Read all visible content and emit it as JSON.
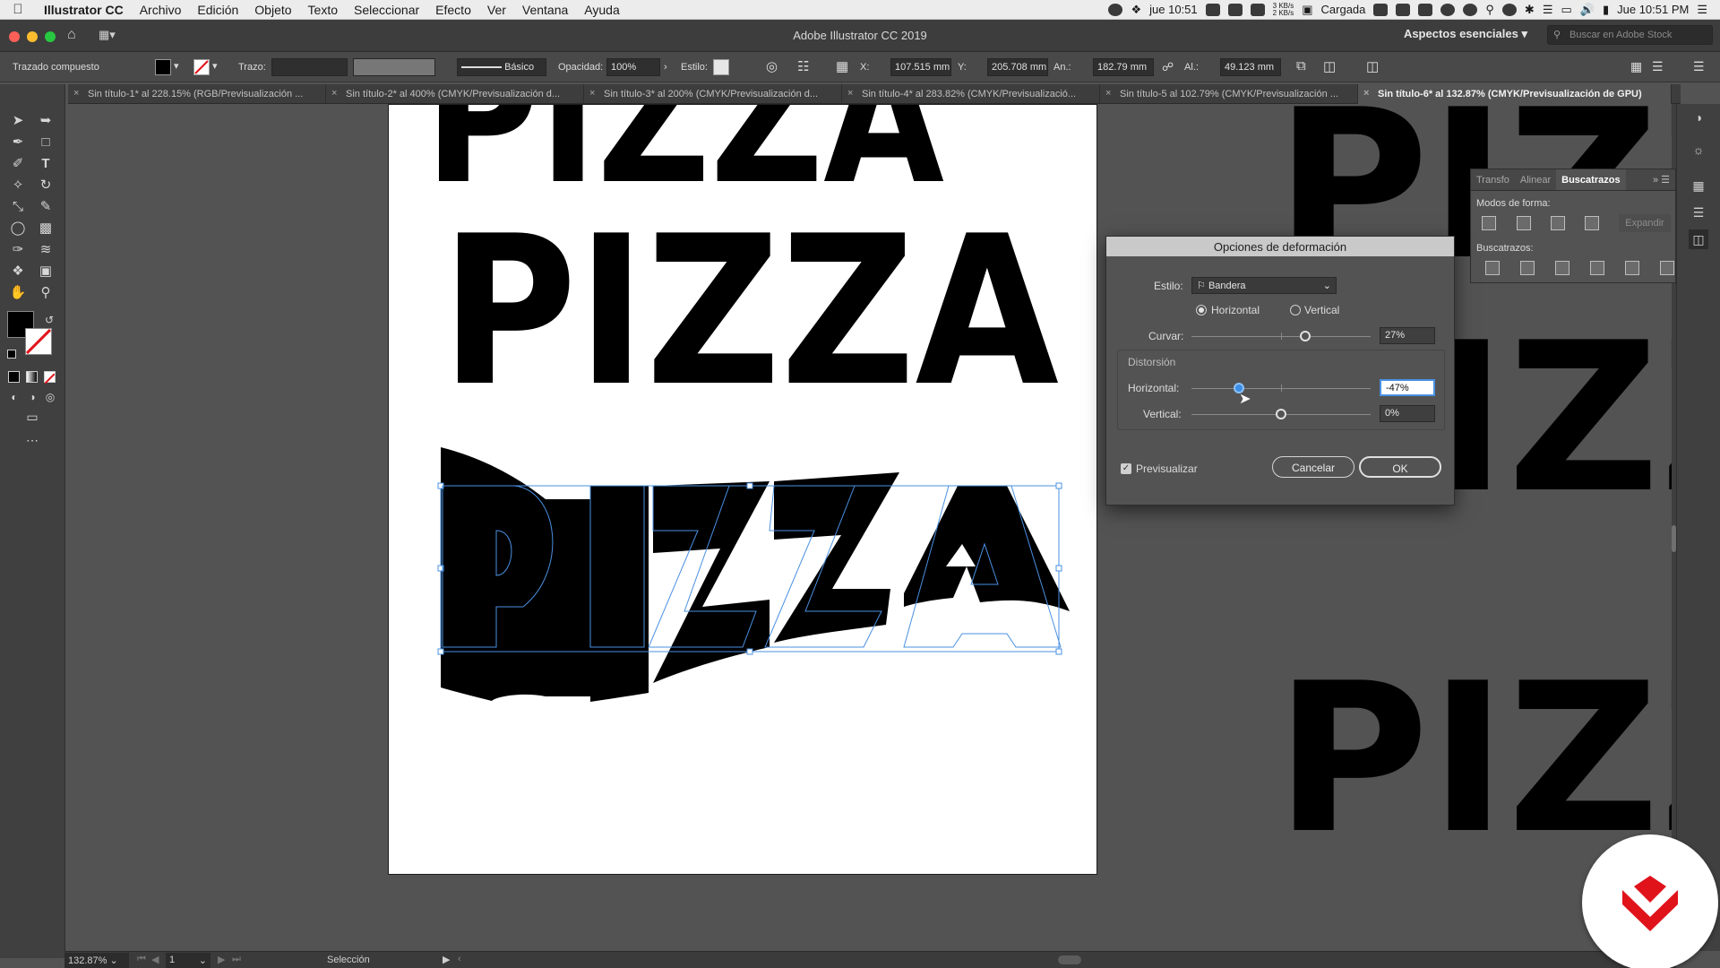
{
  "menubar": {
    "app_name": "Illustrator CC",
    "items": [
      "Archivo",
      "Edición",
      "Objeto",
      "Texto",
      "Seleccionar",
      "Efecto",
      "Ver",
      "Ventana",
      "Ayuda"
    ],
    "status_time_short": "jue 10:51",
    "net_up": "3 KB/s",
    "net_down": "2 KB/s",
    "battery_label": "Cargada",
    "clock": "Jue 10:51 PM"
  },
  "titlebar": {
    "title": "Adobe Illustrator CC 2019",
    "workspace": "Aspectos esenciales",
    "stock_search_placeholder": "Buscar en Adobe Stock"
  },
  "controlbar": {
    "object_type": "Trazado compuesto",
    "stroke_label": "Trazo:",
    "brush_label": "Básico",
    "opacity_label": "Opacidad:",
    "opacity_value": "100%",
    "style_label": "Estilo:",
    "x_label": "X:",
    "x_value": "107.515 mm",
    "y_label": "Y:",
    "y_value": "205.708 mm",
    "w_label": "An.:",
    "w_value": "182.79 mm",
    "h_label": "Al.:",
    "h_value": "49.123 mm"
  },
  "tabs": [
    {
      "label": "Sin título-1* al 228.15% (RGB/Previsualización ...",
      "active": false
    },
    {
      "label": "Sin título-2* al 400% (CMYK/Previsualización d...",
      "active": false
    },
    {
      "label": "Sin título-3* al 200% (CMYK/Previsualización d...",
      "active": false
    },
    {
      "label": "Sin título-4* al 283.82% (CMYK/Previsualizació...",
      "active": false
    },
    {
      "label": "Sin título-5 al 102.79% (CMYK/Previsualización ...",
      "active": false
    },
    {
      "label": "Sin título-6* al 132.87% (CMYK/Previsualización de GPU)",
      "active": true
    }
  ],
  "artwork": {
    "text_top": "PIZZA",
    "text_main": "PIZZA",
    "text_warped": "PIZZA",
    "text_right_top": "PIZZ",
    "text_right_bottom": "PIZZ"
  },
  "pathfinder": {
    "tabs": [
      "Transfo",
      "Alinear",
      "Buscatrazos"
    ],
    "shape_modes_label": "Modos de forma:",
    "expand_label": "Expandir",
    "pathfinders_label": "Buscatrazos:"
  },
  "warp_dialog": {
    "title": "Opciones de deformación",
    "style_label": "Estilo:",
    "style_value": "Bandera",
    "horizontal_option": "Horizontal",
    "vertical_option": "Vertical",
    "orientation_selected": "Horizontal",
    "bend_label": "Curvar:",
    "bend_value": "27%",
    "bend_fraction": 0.635,
    "distortion_label": "Distorsión",
    "dist_h_label": "Horizontal:",
    "dist_h_value": "-47%",
    "dist_h_fraction": 0.265,
    "dist_v_label": "Vertical:",
    "dist_v_value": "0%",
    "dist_v_fraction": 0.5,
    "preview_label": "Previsualizar",
    "preview_checked": true,
    "cancel_label": "Cancelar",
    "ok_label": "OK"
  },
  "statusbar": {
    "zoom": "132.87%",
    "page": "1",
    "tool_label": "Selección"
  },
  "colors": {
    "selection_blue": "#4a90e2",
    "logo_red": "#e0131b"
  }
}
